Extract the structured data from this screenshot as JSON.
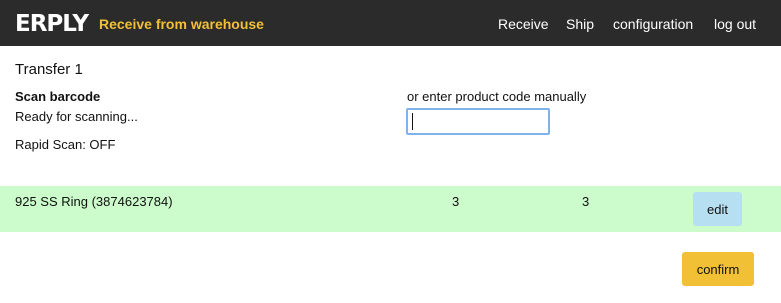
{
  "header": {
    "logo_text": "ERPLY",
    "subtitle": "Receive from warehouse",
    "nav": {
      "receive": "Receive",
      "ship": "Ship",
      "configuration": "configuration",
      "logout": "log out"
    }
  },
  "main": {
    "transfer_title": "Transfer 1",
    "scan_label": "Scan barcode",
    "scan_status": "Ready for scanning...",
    "rapid_scan": "Rapid Scan: OFF",
    "manual_label": "or enter product code manually",
    "manual_input_value": ""
  },
  "items": [
    {
      "name": "925 SS Ring (3874623784)",
      "qty_expected": "3",
      "qty_received": "3",
      "edit_label": "edit"
    }
  ],
  "footer": {
    "confirm_label": "confirm"
  },
  "colors": {
    "topbar": "#2b2b2b",
    "accent": "#f2c035",
    "row_highlight": "#ccfccc",
    "edit_button": "#b7dff2",
    "input_focus": "#7eb4ea"
  }
}
